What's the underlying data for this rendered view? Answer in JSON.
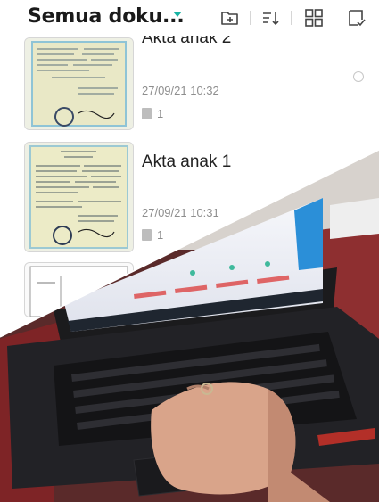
{
  "header": {
    "title": "Semua doku...",
    "icons": [
      "new-folder-icon",
      "sort-icon",
      "grid-view-icon",
      "multi-select-icon"
    ]
  },
  "documents": [
    {
      "name": "Akta anak 2",
      "date": "27/09/21 10:32",
      "pages": "1"
    },
    {
      "name": "Akta anak 1",
      "date": "27/09/21 10:31",
      "pages": "1"
    }
  ],
  "colors": {
    "accent": "#17b3a3",
    "text": "#1a1a1a",
    "muted": "#8e8e8e"
  }
}
